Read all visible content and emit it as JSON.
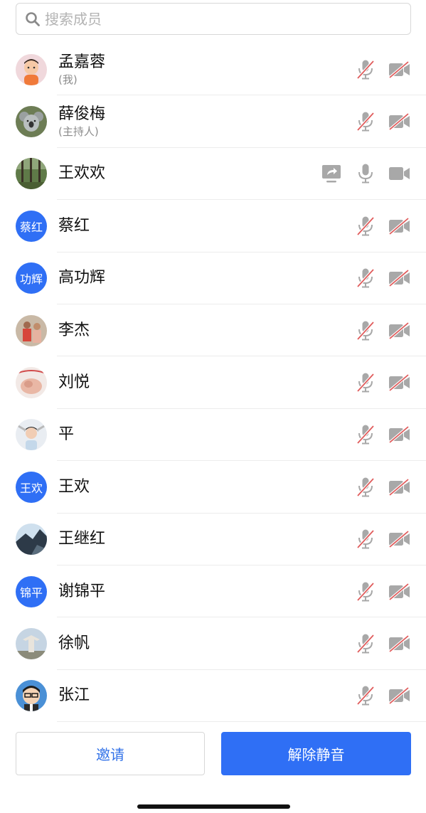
{
  "search": {
    "placeholder": "搜索成员",
    "value": ""
  },
  "colors": {
    "accent": "#2f6ff5",
    "muted_red": "#e05b5b",
    "icon_gray": "#a8a8a8"
  },
  "members": [
    {
      "name": "孟嘉蓉",
      "subtitle": "(我)",
      "avatar_type": "photo",
      "avatar_desc": "baby-photo",
      "mic_muted": true,
      "video_off": true,
      "sharing": false
    },
    {
      "name": "薛俊梅",
      "subtitle": "(主持人)",
      "avatar_type": "photo",
      "avatar_desc": "koala-photo",
      "mic_muted": true,
      "video_off": true,
      "sharing": false
    },
    {
      "name": "王欢欢",
      "subtitle": "",
      "avatar_type": "photo",
      "avatar_desc": "forest-photo",
      "mic_muted": false,
      "video_off": false,
      "sharing": true
    },
    {
      "name": "蔡红",
      "subtitle": "",
      "avatar_type": "text",
      "avatar_text": "蔡红",
      "mic_muted": true,
      "video_off": true,
      "sharing": false
    },
    {
      "name": "高功辉",
      "subtitle": "",
      "avatar_type": "text",
      "avatar_text": "功辉",
      "mic_muted": true,
      "video_off": true,
      "sharing": false
    },
    {
      "name": "李杰",
      "subtitle": "",
      "avatar_type": "photo",
      "avatar_desc": "people-photo",
      "mic_muted": true,
      "video_off": true,
      "sharing": false
    },
    {
      "name": "刘悦",
      "subtitle": "",
      "avatar_type": "photo",
      "avatar_desc": "hands-photo",
      "mic_muted": true,
      "video_off": true,
      "sharing": false
    },
    {
      "name": "平",
      "subtitle": "",
      "avatar_type": "photo",
      "avatar_desc": "girl-photo",
      "mic_muted": true,
      "video_off": true,
      "sharing": false
    },
    {
      "name": "王欢",
      "subtitle": "",
      "avatar_type": "text",
      "avatar_text": "王欢",
      "mic_muted": true,
      "video_off": true,
      "sharing": false
    },
    {
      "name": "王继红",
      "subtitle": "",
      "avatar_type": "photo",
      "avatar_desc": "mountain-photo",
      "mic_muted": true,
      "video_off": true,
      "sharing": false
    },
    {
      "name": "谢锦平",
      "subtitle": "",
      "avatar_type": "text",
      "avatar_text": "锦平",
      "mic_muted": true,
      "video_off": true,
      "sharing": false
    },
    {
      "name": "徐帆",
      "subtitle": "",
      "avatar_type": "photo",
      "avatar_desc": "statue-photo",
      "mic_muted": true,
      "video_off": true,
      "sharing": false
    },
    {
      "name": "张江",
      "subtitle": "",
      "avatar_type": "photo",
      "avatar_desc": "cartoon-man-photo",
      "mic_muted": true,
      "video_off": true,
      "sharing": false
    }
  ],
  "buttons": {
    "invite": "邀请",
    "unmute_all": "解除静音"
  }
}
